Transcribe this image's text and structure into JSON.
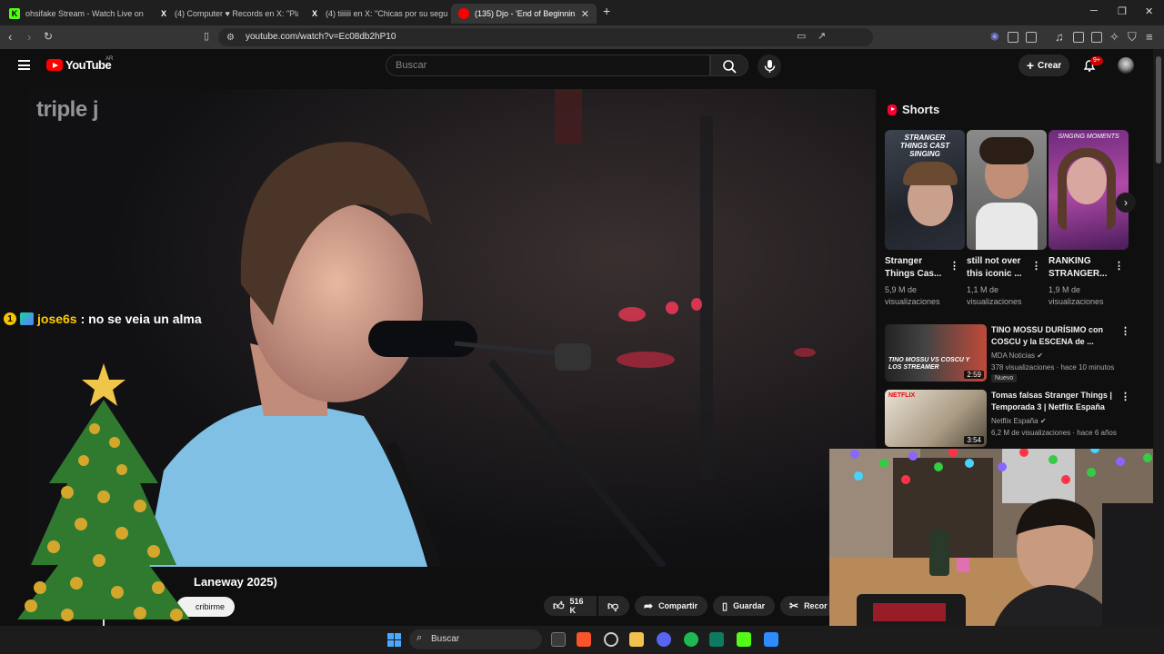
{
  "browser": {
    "tabs": [
      {
        "label": "ohsifake Stream - Watch Live on"
      },
      {
        "label": "(4) Computer ♥ Records en X: \"PlayS"
      },
      {
        "label": "(4) tiiiiii en X: \"Chicas por su segurida"
      },
      {
        "label": "(135) Djo - 'End of Beginning' (li"
      }
    ],
    "url": "youtube.com/watch?v=Ec08db2hP10"
  },
  "youtube": {
    "brand": "YouTube",
    "country": "AR",
    "search_placeholder": "Buscar",
    "create_label": "Crear",
    "notifications_badge": "9+"
  },
  "video": {
    "watermark": "triple j",
    "title_visible": "Laneway 2025)",
    "subscribe_label": "cribirme",
    "likes": "516 K",
    "share_label": "Compartir",
    "save_label": "Guardar",
    "clip_label": "Recor"
  },
  "shorts": {
    "heading": "Shorts",
    "items": [
      {
        "title": "Stranger Things Cas...",
        "views": "5,9 M de visualizaciones",
        "thumb_text": "STRANGER THINGS CAST SINGING"
      },
      {
        "title": "still not over this iconic ...",
        "views": "1,1 M de visualizaciones"
      },
      {
        "title": "RANKING STRANGER...",
        "views": "1,9 M de visualizaciones",
        "thumb_text": "SINGING MOMENTS"
      }
    ]
  },
  "recommendations": [
    {
      "title": "TINO MOSSU DURÍSIMO con COSCU y la ESCENA de ...",
      "channel": "MDA Noticias",
      "meta": "378 visualizaciones · hace 10 minutos",
      "badge": "Nuevo",
      "duration": "2:59",
      "thumb_text": "TINO MOSSU VS COSCU Y LOS STREAMER"
    },
    {
      "title": "Tomas falsas Stranger Things | Temporada 3 | Netflix España",
      "channel": "Netflix España",
      "meta": "6,2 M de visualizaciones · hace 6 años",
      "duration": "3:54",
      "thumb_text": "NETFLIX"
    }
  ],
  "overlay": {
    "chat_badge": "1",
    "chat_user": "jose6s",
    "chat_message": ": no se veia un alma"
  },
  "taskbar": {
    "search_label": "Buscar"
  },
  "colors": {
    "background": "#0f0f0f",
    "youtube_red": "#ff0000",
    "chat_user": "#ffcc00"
  }
}
